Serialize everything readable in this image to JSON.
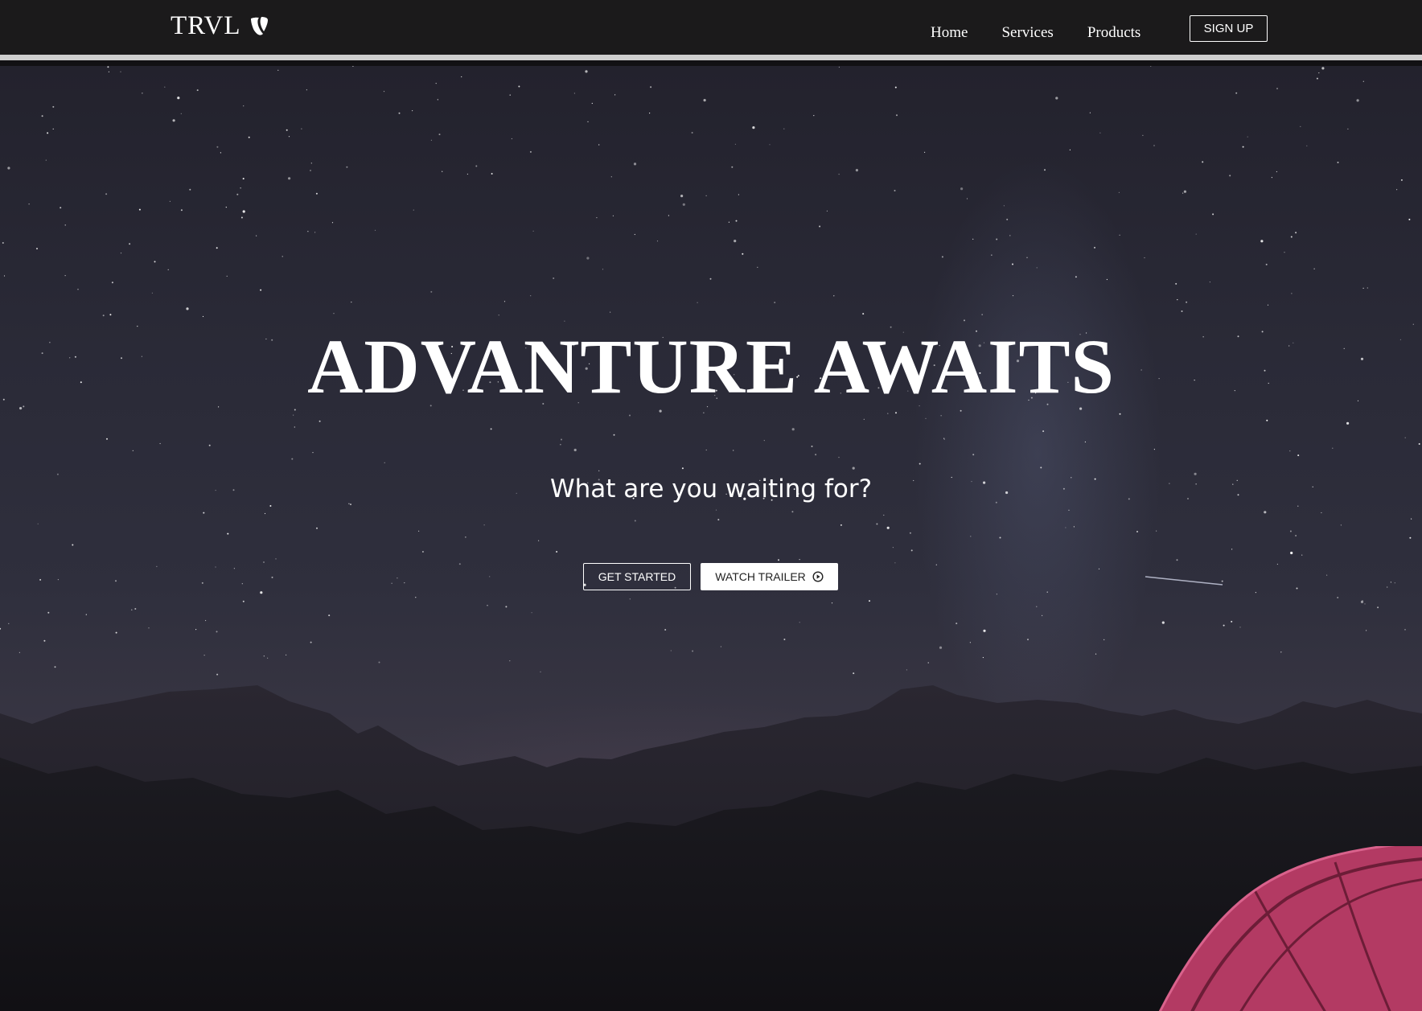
{
  "brand": {
    "name": "TRVL",
    "logo_icon": "typo3-icon"
  },
  "nav": {
    "links": [
      {
        "label": "Home"
      },
      {
        "label": "Services"
      },
      {
        "label": "Products"
      }
    ],
    "signup_label": "SIGN UP"
  },
  "hero": {
    "title": "ADVANTURE AWAITS",
    "subtitle": "What are you waiting for?",
    "get_started_label": "GET STARTED",
    "watch_trailer_label": "WATCH TRAILER",
    "watch_trailer_icon": "play-circle-icon"
  },
  "colors": {
    "navbar_bg": "#1b1a1b",
    "navbar_border": "#cfcfcf",
    "text": "#ffffff",
    "tent": "#c2456f"
  }
}
